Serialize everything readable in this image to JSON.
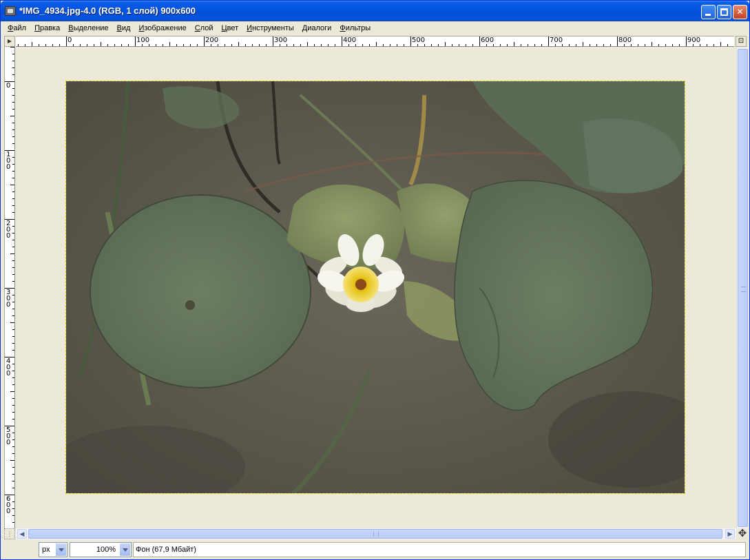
{
  "window": {
    "title": "*IMG_4934.jpg-4.0 (RGB, 1 слой) 900x600",
    "app_icon": "gimp-image-icon",
    "controls": [
      "minimize-icon",
      "maximize-icon",
      "close-icon"
    ],
    "close_glyph": "✕"
  },
  "menu": [
    {
      "accel": "Ф",
      "rest": "айл"
    },
    {
      "accel": "П",
      "rest": "равка"
    },
    {
      "accel": "В",
      "rest": "ыделение"
    },
    {
      "accel": "В",
      "rest": "ид"
    },
    {
      "accel": "И",
      "rest": "зображение"
    },
    {
      "accel": "С",
      "rest": "лой"
    },
    {
      "accel": "Ц",
      "rest": "вет"
    },
    {
      "accel": "И",
      "rest": "нструменты"
    },
    {
      "accel": "Д",
      "rest": "иалоги"
    },
    {
      "accel": "Ф",
      "rest": "ильтры"
    }
  ],
  "rulers": {
    "horizontal_labels": [
      "0",
      "100",
      "200",
      "300",
      "400",
      "500",
      "600",
      "700",
      "800",
      "900"
    ],
    "vertical_labels": [
      "0",
      "100",
      "200",
      "300",
      "400",
      "500",
      "600"
    ]
  },
  "canvas": {
    "image_name": "IMG_4934.jpg",
    "image_width": 900,
    "image_height": 600,
    "colors": {
      "water": "#5d5a4e",
      "pad": "#5f6e58",
      "pad_light": "#7a8a62",
      "flower": "#f2f1e6",
      "center": "#e8c417",
      "selection": "#d8d800"
    }
  },
  "statusbar": {
    "unit": "px",
    "zoom": "100%",
    "layer_info": "Фон (67,9 Мбайт)"
  },
  "icons": {
    "quick_mask": "quick-mask-icon",
    "navigate": "navigate-icon",
    "nav_glyph": "✥",
    "ruler_corner": "menu-arrow-icon"
  }
}
